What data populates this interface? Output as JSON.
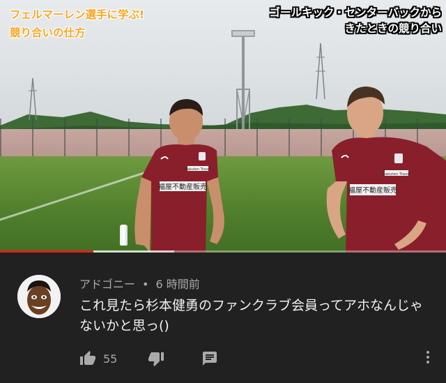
{
  "video": {
    "caption_left": [
      "フェルマーレン選手に学ぶ!",
      "競り合いの仕方"
    ],
    "caption_right": [
      "ゴールキック・センターバックから",
      "きたときの競り合い"
    ],
    "sponsor_left_chest": "Rakuten Travel",
    "sponsor_left_front": "福屋不動産販売",
    "sponsor_right_chest": "Rakuten Travel",
    "sponsor_right_front": "福屋不動産販売",
    "played_fraction": 0.21,
    "loaded_fraction": 0.39,
    "colors": {
      "caption_left": "#f5a623",
      "jersey": "#8a1f2c",
      "progress": "#e62117"
    }
  },
  "comment": {
    "author": "アドゴニー",
    "separator": "•",
    "time": "6 時間前",
    "text": "これ見たら杉本健勇のファンクラブ会員ってアホなんじゃないかと思っ()",
    "like_count": "55",
    "icons": {
      "like": "thumbs-up-icon",
      "dislike": "thumbs-down-icon",
      "reply": "comment-icon",
      "more": "more-vertical-icon"
    }
  }
}
